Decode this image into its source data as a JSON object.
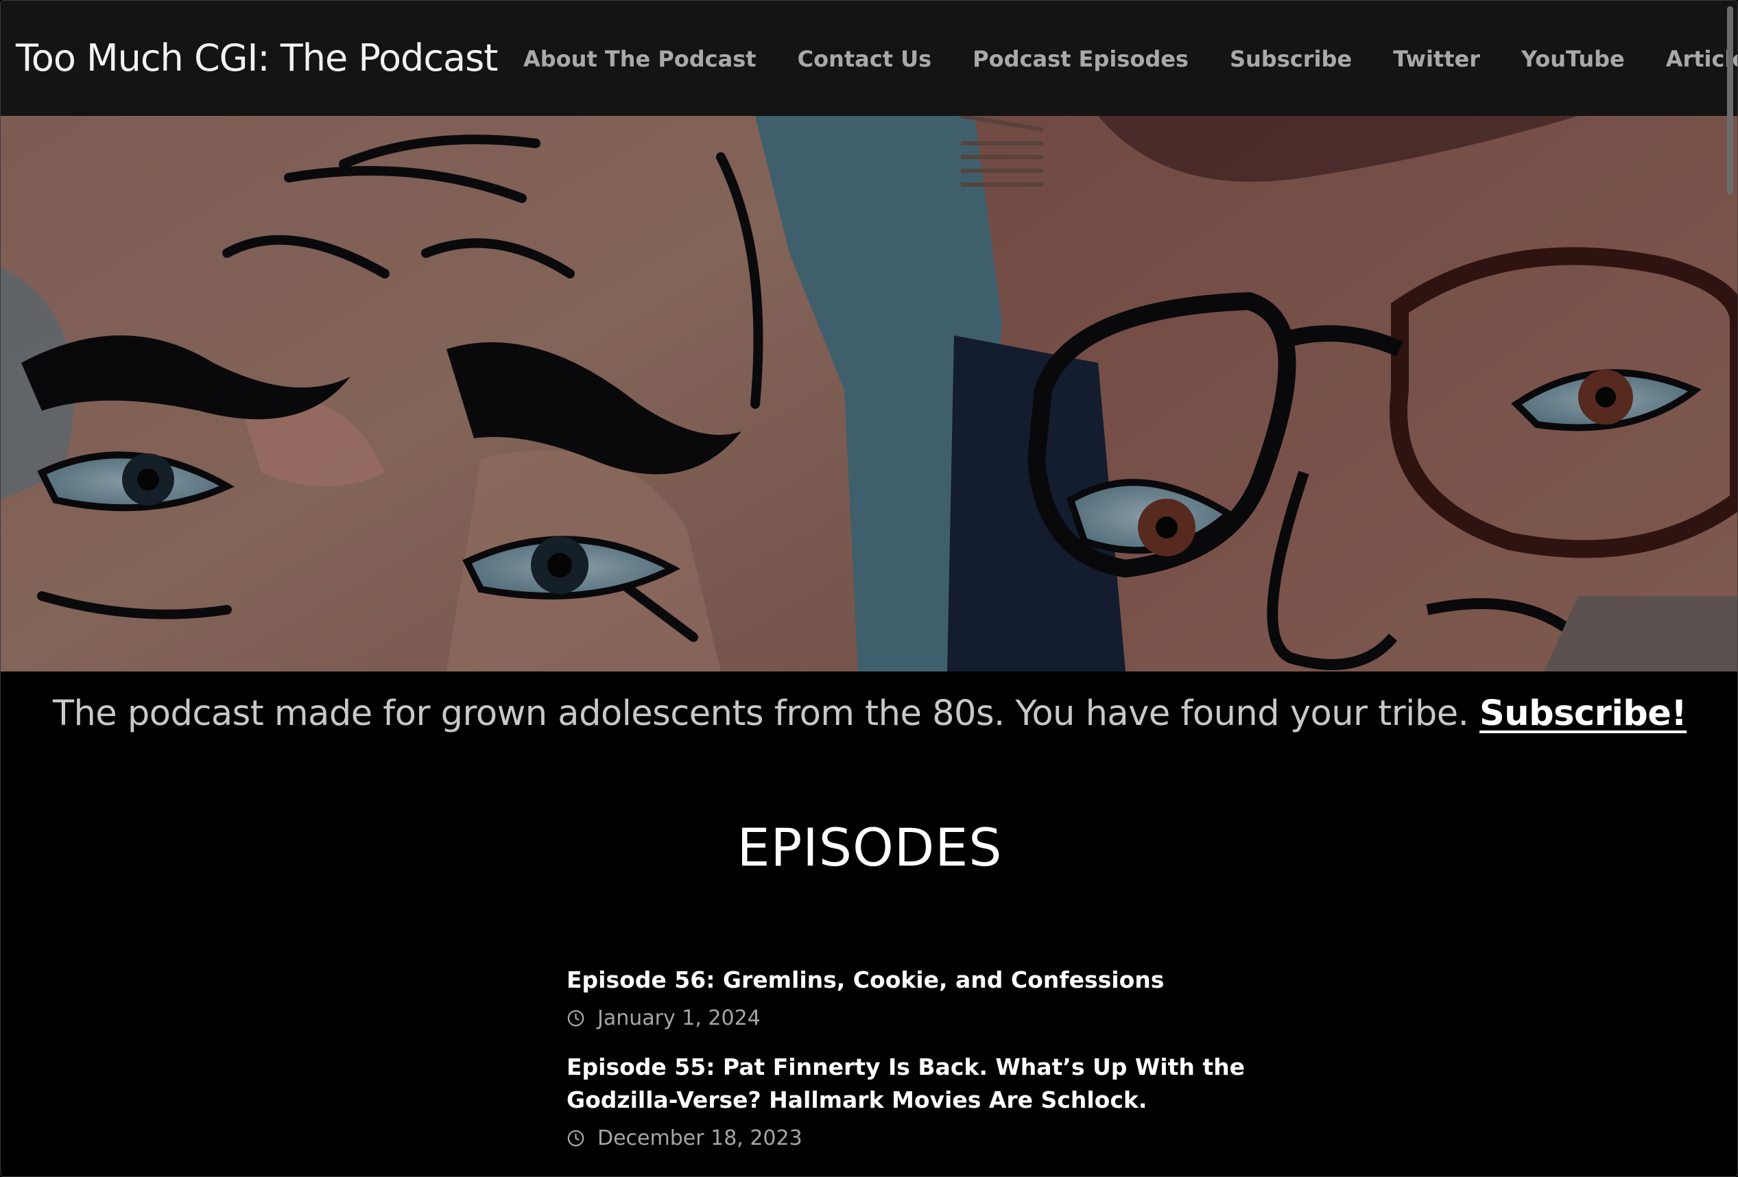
{
  "header": {
    "site_title": "Too Much CGI: The Podcast",
    "nav": [
      {
        "label": "About The Podcast"
      },
      {
        "label": "Contact Us"
      },
      {
        "label": "Podcast Episodes"
      },
      {
        "label": "Subscribe"
      },
      {
        "label": "Twitter"
      },
      {
        "label": "YouTube"
      },
      {
        "label": "Articles"
      }
    ]
  },
  "hero": {
    "image": "comic-style illustration of two faces"
  },
  "tagline": {
    "text": "The podcast made for grown adolescents from the 80s. You have found your tribe.",
    "link_label": "Subscribe!"
  },
  "section": {
    "heading": "EPISODES"
  },
  "episodes": [
    {
      "title": "Episode 56: Gremlins, Cookie, and Confessions",
      "date": "January 1, 2024",
      "icon": "clock-icon"
    },
    {
      "title": "Episode 55: Pat Finnerty Is Back. What’s Up With the Godzilla-Verse? Hallmark Movies Are Schlock.",
      "date": "December 18, 2023",
      "icon": "clock-icon"
    }
  ],
  "colors": {
    "header_bg": "#141414",
    "page_bg": "#000000",
    "nav_text": "#a9a9a9",
    "title_text": "#f2f2f2"
  }
}
